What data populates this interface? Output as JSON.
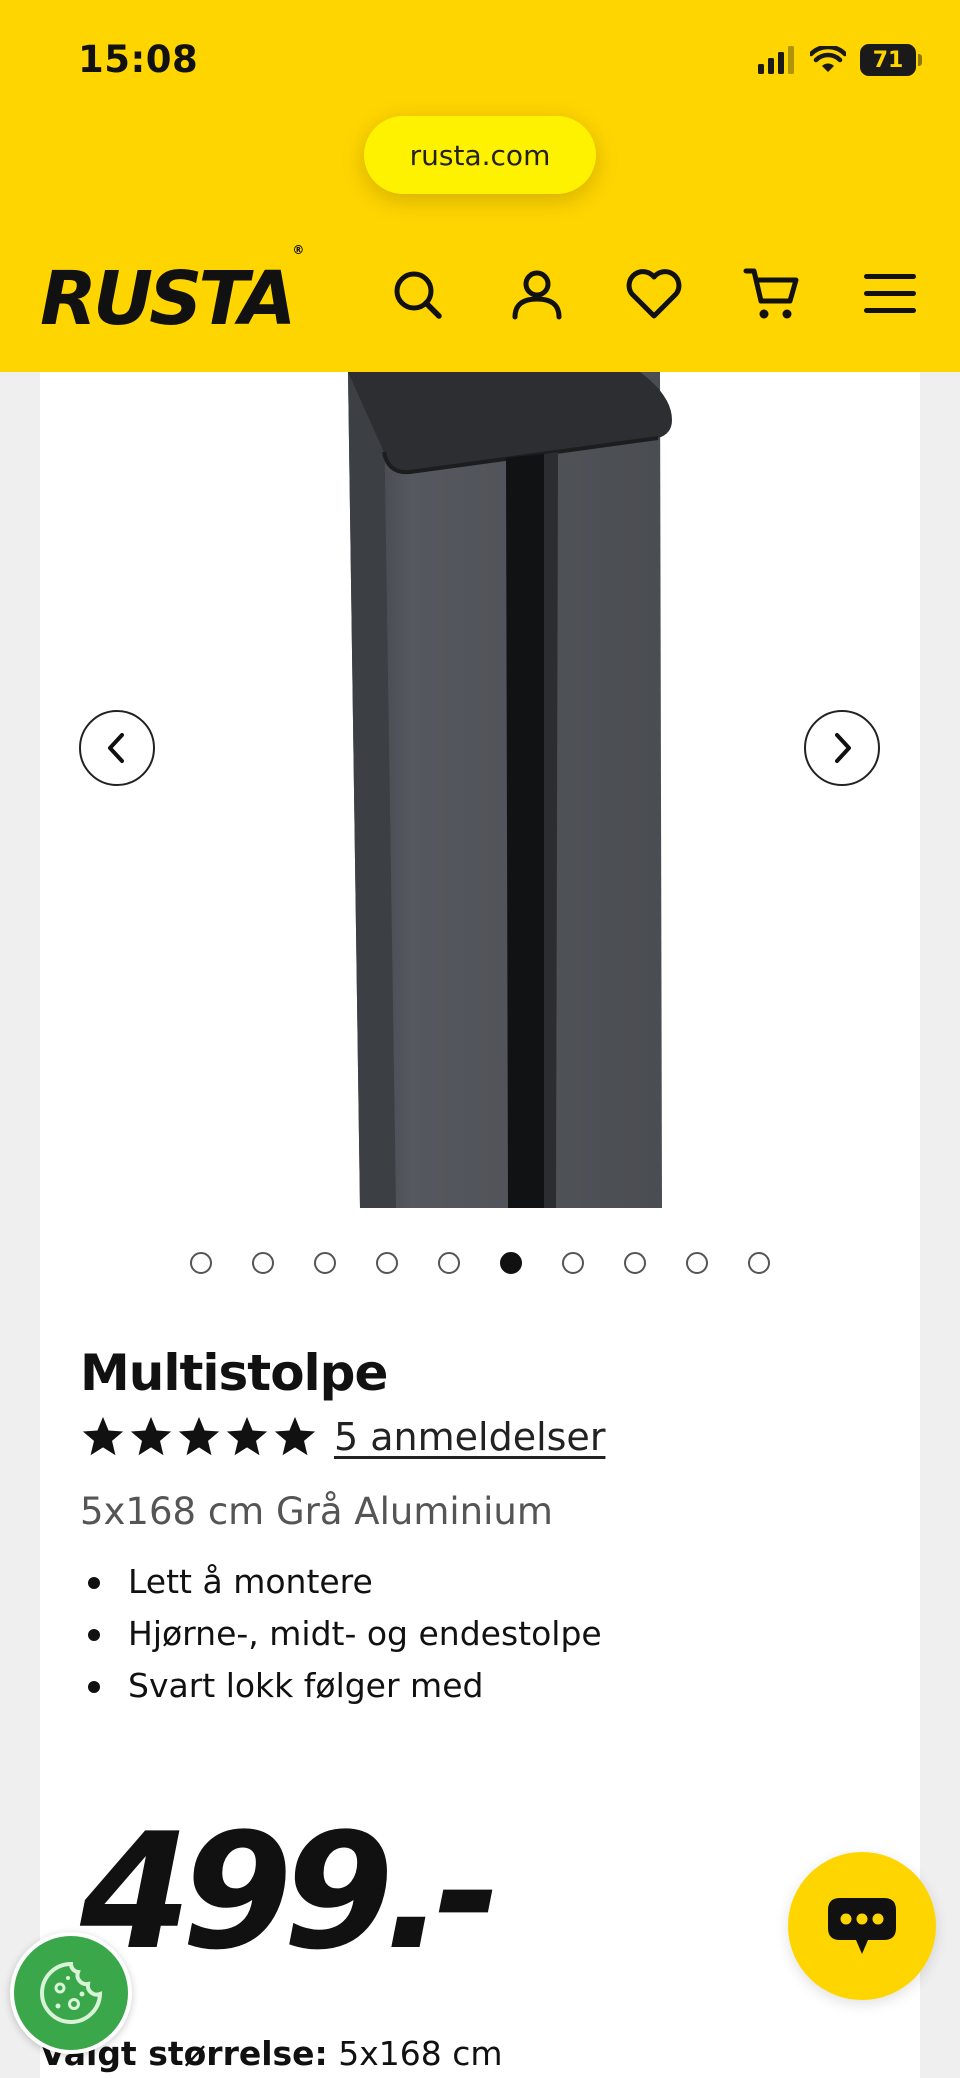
{
  "status_bar": {
    "time": "15:08",
    "battery": "71"
  },
  "browser": {
    "url": "rusta.com"
  },
  "header": {
    "logo": "RUSTA",
    "logo_mark": "®"
  },
  "gallery": {
    "total_images": 10,
    "active_index": 5
  },
  "product": {
    "title": "Multistolpe",
    "rating_stars": 5,
    "reviews_link": "5 anmeldelser",
    "subtitle": "5x168 cm Grå Aluminium",
    "features": [
      "Lett å montere",
      "Hjørne-, midt- og endestolpe",
      "Svart lokk følger med"
    ],
    "price": "499.-",
    "size_label": "Valgt størrelse:",
    "size_value": "5x168 cm"
  },
  "colors": {
    "brand_yellow": "#ffd500",
    "cookie_green": "#3aa74a",
    "text_dark": "#111111"
  }
}
